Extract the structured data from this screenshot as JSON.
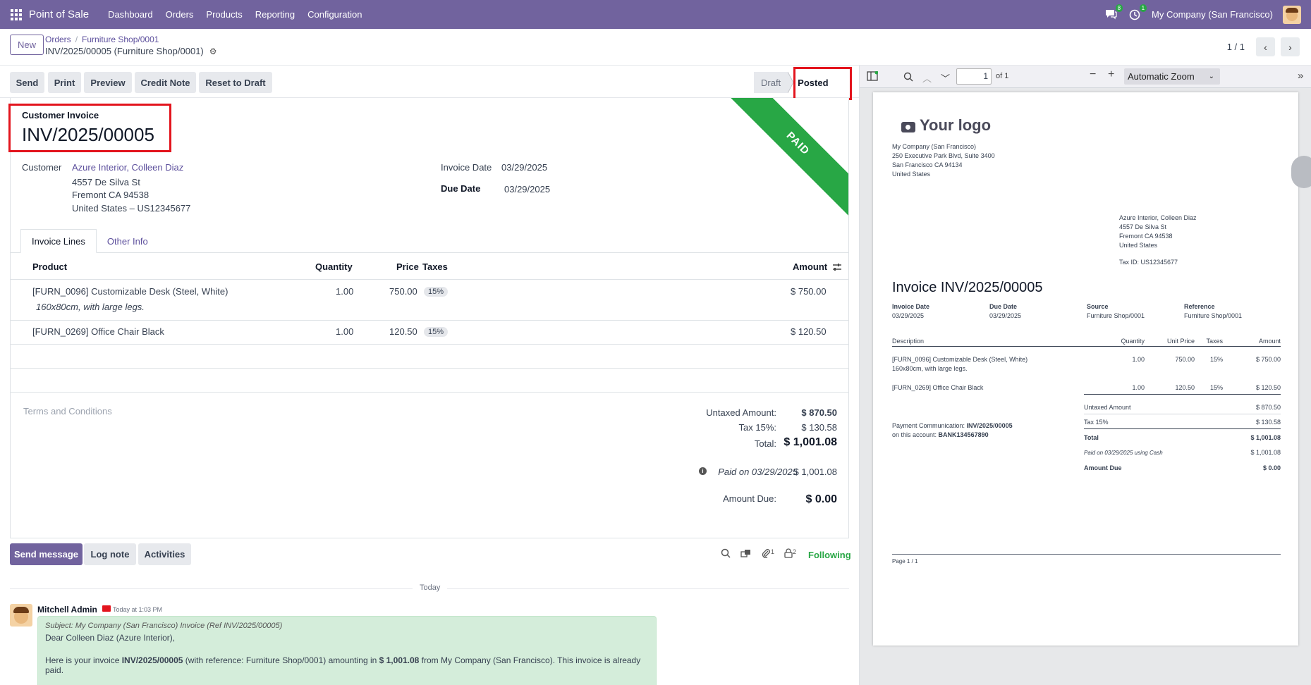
{
  "navbar": {
    "app_name": "Point of Sale",
    "menu": [
      "Dashboard",
      "Orders",
      "Products",
      "Reporting",
      "Configuration"
    ],
    "chat_count": "8",
    "activity_count": "1",
    "company": "My Company (San Francisco)",
    "accent": "#71639e"
  },
  "control": {
    "new_label": "New",
    "breadcrumb_1": "Orders",
    "breadcrumb_2": "Furniture Shop/0001",
    "record_title": "INV/2025/00005 (Furniture Shop/0001)",
    "pager": "1 / 1"
  },
  "actions": {
    "send": "Send",
    "print": "Print",
    "preview": "Preview",
    "credit_note": "Credit Note",
    "reset": "Reset to Draft",
    "status_draft": "Draft",
    "status_posted": "Posted"
  },
  "invoice": {
    "type_label": "Customer Invoice",
    "name": "INV/2025/00005",
    "ribbon": "PAID",
    "customer_label": "Customer",
    "customer_name": "Azure Interior, Colleen Diaz",
    "address_1": "4557 De Silva St",
    "address_2": "Fremont CA 94538",
    "address_3": "United States – US12345677",
    "invoice_date_label": "Invoice Date",
    "invoice_date": "03/29/2025",
    "due_date_label": "Due Date",
    "due_date": "03/29/2025"
  },
  "tabs": {
    "lines": "Invoice Lines",
    "other": "Other Info"
  },
  "table": {
    "headers": {
      "product": "Product",
      "quantity": "Quantity",
      "price": "Price",
      "taxes": "Taxes",
      "amount": "Amount"
    },
    "rows": [
      {
        "product": "[FURN_0096] Customizable Desk (Steel, White)",
        "description": "160x80cm, with large legs.",
        "quantity": "1.00",
        "price": "750.00",
        "tax": "15%",
        "amount": "$ 750.00"
      },
      {
        "product": "[FURN_0269] Office Chair Black",
        "quantity": "1.00",
        "price": "120.50",
        "tax": "15%",
        "amount": "$ 120.50"
      }
    ]
  },
  "totals": {
    "terms_placeholder": "Terms and Conditions",
    "untaxed_label": "Untaxed Amount:",
    "untaxed": "$ 870.50",
    "tax_label": "Tax 15%:",
    "tax": "$ 130.58",
    "total_label": "Total:",
    "total": "$ 1,001.08",
    "paid_label": "Paid on 03/29/2025",
    "paid": "$ 1,001.08",
    "due_label": "Amount Due:",
    "due": "$ 0.00"
  },
  "chatter": {
    "send_message": "Send message",
    "log_note": "Log note",
    "activities": "Activities",
    "attachments_count": "1",
    "followers_count": "2",
    "following": "Following",
    "today": "Today",
    "author": "Mitchell Admin",
    "time": "Today at 1:03 PM",
    "subject": "Subject: My Company (San Francisco) Invoice (Ref INV/2025/00005)",
    "greeting": "Dear Colleen Diaz (Azure Interior),",
    "body_1": "Here is your invoice ",
    "body_ref": "INV/2025/00005",
    "body_2": " (with reference: Furniture Shop/0001) amounting in ",
    "body_amount": "$ 1,001.08",
    "body_3": " from My Company (San Francisco). This invoice is already paid."
  },
  "pdf": {
    "page_input": "1",
    "page_of": "of 1",
    "zoom": "Automatic Zoom",
    "logo": "Your logo",
    "company_lines": [
      "My Company (San Francisco)",
      "250 Executive Park Blvd, Suite 3400",
      "San Francisco CA 94134",
      "United States"
    ],
    "customer_lines": [
      "Azure Interior, Colleen Diaz",
      "4557 De Silva St",
      "Fremont CA 94538",
      "United States"
    ],
    "tax_id": "Tax ID: US12345677",
    "title": "Invoice INV/2025/00005",
    "meta": [
      {
        "label": "Invoice Date",
        "value": "03/29/2025"
      },
      {
        "label": "Due Date",
        "value": "03/29/2025"
      },
      {
        "label": "Source",
        "value": "Furniture Shop/0001"
      },
      {
        "label": "Reference",
        "value": "Furniture Shop/0001"
      }
    ],
    "headers": {
      "description": "Description",
      "quantity": "Quantity",
      "unit_price": "Unit Price",
      "taxes": "Taxes",
      "amount": "Amount"
    },
    "rows": [
      {
        "desc": "[FURN_0096] Customizable Desk (Steel, White)",
        "desc2": "160x80cm, with large legs.",
        "qty": "1.00",
        "price": "750.00",
        "tax": "15%",
        "amount": "$ 750.00"
      },
      {
        "desc": "[FURN_0269] Office Chair Black",
        "qty": "1.00",
        "price": "120.50",
        "tax": "15%",
        "amount": "$ 120.50"
      }
    ],
    "payment_comm_label": "Payment Communication: ",
    "payment_comm": "INV/2025/00005",
    "account_label": "on this account: ",
    "account": "BANK134567890",
    "totals": [
      {
        "label": "Untaxed Amount",
        "value": "$ 870.50"
      },
      {
        "label": "Tax 15%",
        "value": "$ 130.58"
      },
      {
        "label": "Total",
        "value": "$ 1,001.08"
      },
      {
        "label": "Paid on 03/29/2025 using Cash",
        "value": "$ 1,001.08"
      },
      {
        "label": "Amount Due",
        "value": "$ 0.00"
      }
    ],
    "footer": "Page 1 / 1"
  }
}
